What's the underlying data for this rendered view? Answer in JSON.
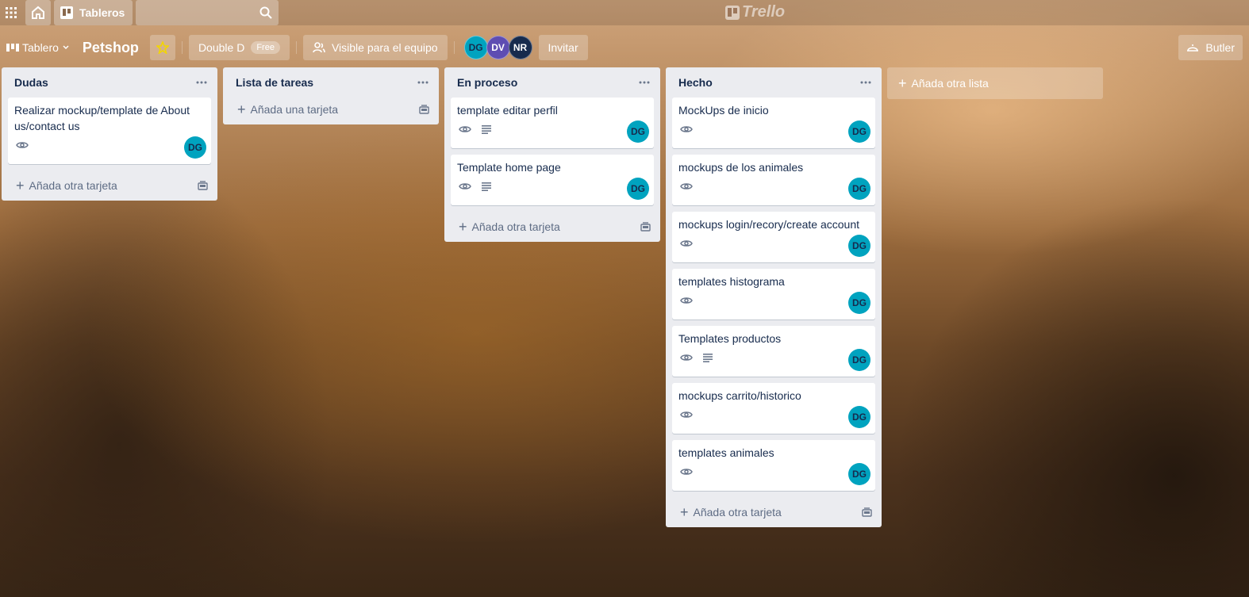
{
  "topbar": {
    "boards_label": "Tableros",
    "logo_text": "Trello"
  },
  "board": {
    "view_label": "Tablero",
    "title": "Petshop",
    "team_name": "Double D",
    "team_plan": "Free",
    "visibility_label": "Visible para el equipo",
    "members": [
      {
        "initials": "DG",
        "color": "#00a3bf"
      },
      {
        "initials": "DV",
        "color": "#5e4db2"
      },
      {
        "initials": "NR",
        "color": "#172b4d"
      }
    ],
    "invite_label": "Invitar",
    "butler_label": "Butler",
    "add_list_label": "Añada otra lista"
  },
  "lists": [
    {
      "title": "Dudas",
      "cards": [
        {
          "title": "Realizar mockup/template de About us/contact us",
          "watch": true,
          "description": false,
          "member": "DG"
        }
      ],
      "composer_label": "Añada otra tarjeta"
    },
    {
      "title": "Lista de tareas",
      "cards": [],
      "composer_label": "Añada una tarjeta"
    },
    {
      "title": "En proceso",
      "cards": [
        {
          "title": "template editar perfil",
          "watch": true,
          "description": true,
          "member": "DG"
        },
        {
          "title": "Template home page",
          "watch": true,
          "description": true,
          "member": "DG"
        }
      ],
      "composer_label": "Añada otra tarjeta"
    },
    {
      "title": "Hecho",
      "cards": [
        {
          "title": "MockUps de inicio",
          "watch": true,
          "description": false,
          "member": "DG"
        },
        {
          "title": "mockups de los animales",
          "watch": true,
          "description": false,
          "member": "DG"
        },
        {
          "title": "mockups login/recory/create account",
          "watch": true,
          "description": false,
          "member": "DG"
        },
        {
          "title": "templates histograma",
          "watch": true,
          "description": false,
          "member": "DG"
        },
        {
          "title": "Templates productos",
          "watch": true,
          "description": true,
          "member": "DG"
        },
        {
          "title": "mockups carrito/historico",
          "watch": true,
          "description": false,
          "member": "DG"
        },
        {
          "title": "templates animales",
          "watch": true,
          "description": false,
          "member": "DG"
        }
      ],
      "composer_label": "Añada otra tarjeta"
    }
  ],
  "icons": {
    "apps": "apps-grid-icon",
    "home": "home-icon",
    "boards": "boards-icon",
    "search": "search-icon",
    "star": "star-icon",
    "watch": "eye-icon",
    "description": "description-icon",
    "menu": "ellipsis-icon",
    "add": "plus-icon",
    "template": "template-icon",
    "butler": "butler-icon"
  },
  "colors": {
    "avatar": "#00a3bf",
    "list_bg": "#ebecf0",
    "star": "#f2d600"
  }
}
